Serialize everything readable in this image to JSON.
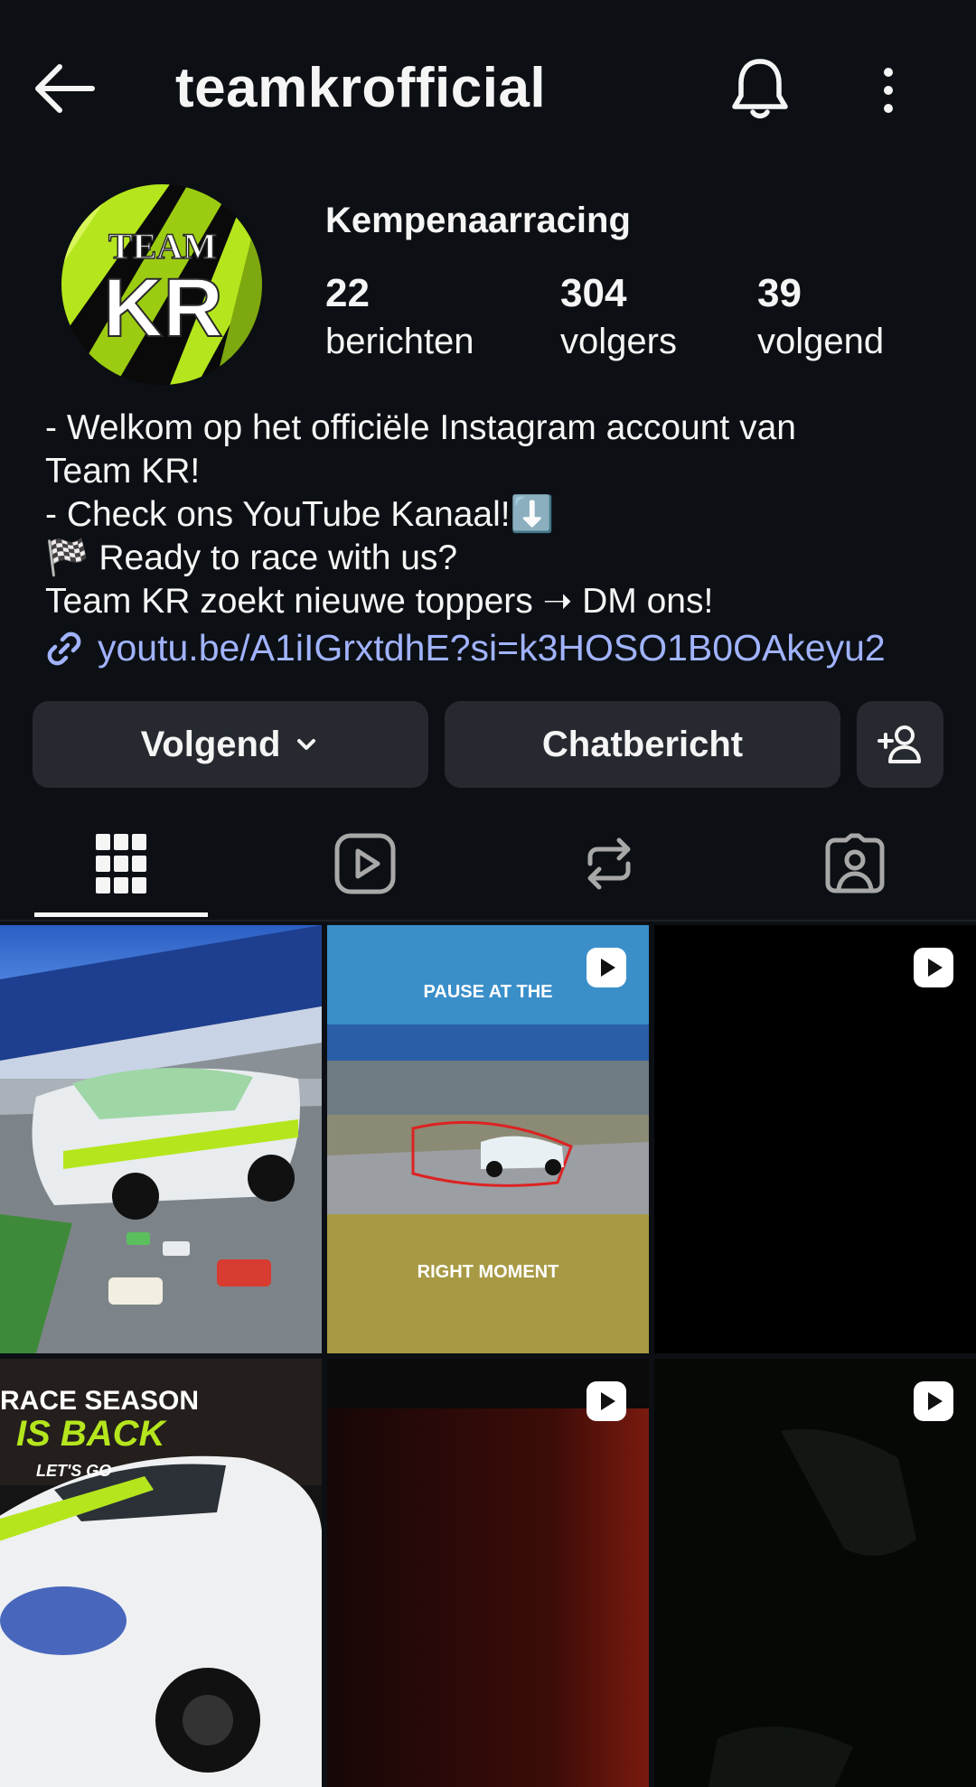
{
  "header": {
    "username": "teamkrofficial",
    "back_icon": "arrow-left-icon",
    "bell_icon": "bell-icon",
    "more_icon": "more-vertical-icon"
  },
  "profile": {
    "display_name": "Kempenaarracing",
    "avatar_text": {
      "top": "TEAM",
      "bottom": "KR"
    },
    "stats": [
      {
        "value": "22",
        "label": "berichten"
      },
      {
        "value": "304",
        "label": "volgers"
      },
      {
        "value": "39",
        "label": "volgend"
      }
    ],
    "bio_lines": [
      "- Welkom op het officiële Instagram account van",
      "Team KR!",
      "- Check ons YouTube Kanaal!⬇️",
      "🏁 Ready to race with us?",
      "Team KR zoekt nieuwe toppers ➝ DM ons!"
    ],
    "link": "youtu.be/A1iIGrxtdhE?si=k3HOSO1B0OAkeyu2"
  },
  "actions": {
    "follow_label": "Volgend",
    "message_label": "Chatbericht"
  },
  "tabs": [
    {
      "name": "posts",
      "icon": "grid-icon",
      "active": true
    },
    {
      "name": "reels",
      "icon": "reels-icon",
      "active": false
    },
    {
      "name": "reposts",
      "icon": "repost-icon",
      "active": false
    },
    {
      "name": "tagged",
      "icon": "tagged-icon",
      "active": false
    }
  ],
  "grid": {
    "post2_top_text": "PAUSE AT THE",
    "post2_bottom_text": "RIGHT MOMENT",
    "post4_line1": "RACE SEASON",
    "post4_line2": "IS BACK",
    "post4_line3": "LET'S GO"
  },
  "colors": {
    "background": "#0c1014",
    "button": "#262a30",
    "link": "#a1b3ff",
    "brand_green": "#b5e61d"
  }
}
